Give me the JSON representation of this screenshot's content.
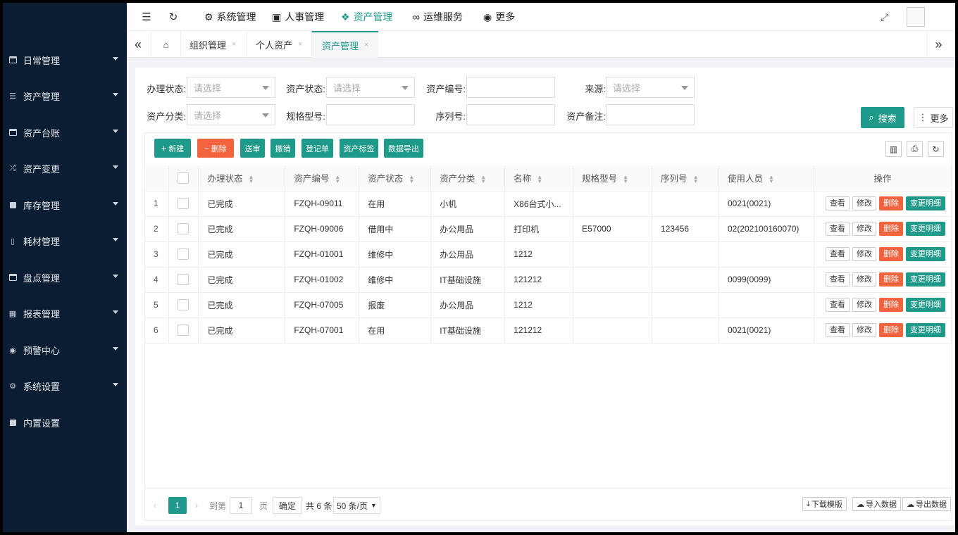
{
  "sidebar": {
    "items": [
      {
        "label": "日常管理",
        "icon": "calendar-icon"
      },
      {
        "label": "资产管理",
        "icon": "server-icon"
      },
      {
        "label": "资产台账",
        "icon": "calendar-icon"
      },
      {
        "label": "资产变更",
        "icon": "shuffle-icon"
      },
      {
        "label": "库存管理",
        "icon": "square-icon"
      },
      {
        "label": "耗材管理",
        "icon": "book-icon"
      },
      {
        "label": "盘点管理",
        "icon": "calendar-check-icon"
      },
      {
        "label": "报表管理",
        "icon": "calendar-grid-icon"
      },
      {
        "label": "预警中心",
        "icon": "dot-circle-icon"
      },
      {
        "label": "系统设置",
        "icon": "gear-icon"
      },
      {
        "label": "内置设置",
        "icon": "square-icon"
      }
    ]
  },
  "topmenu": {
    "items": [
      {
        "label": "系统管理",
        "icon": "gear-icon"
      },
      {
        "label": "人事管理",
        "icon": "id-card-icon"
      },
      {
        "label": "资产管理",
        "icon": "cubes-icon"
      },
      {
        "label": "运维服务",
        "icon": "handshake-icon"
      },
      {
        "label": "更多",
        "icon": "chevron-circle-down-icon"
      }
    ],
    "active": "资产管理"
  },
  "tabs": {
    "items": [
      "组织管理",
      "个人资产",
      "资产管理"
    ],
    "active": "资产管理",
    "close_glyph": "×"
  },
  "filters": {
    "status_label": "办理状态:",
    "asset_status_label": "资产状态:",
    "asset_no_label": "资产编号:",
    "source_label": "来源:",
    "category_label": "资产分类:",
    "model_label": "规格型号:",
    "serial_label": "序列号:",
    "remark_label": "资产备注:",
    "select_placeholder": "请选择",
    "search_label": "搜索",
    "more_label": "更多"
  },
  "toolbar": {
    "new_label": "新建",
    "delete_label": "删除",
    "submit_label": "送审",
    "revoke_label": "撤销",
    "register_label": "登记单",
    "tag_label": "资产标签",
    "export_label": "数据导出"
  },
  "table": {
    "headers": [
      "办理状态",
      "资产编号",
      "资产状态",
      "资产分类",
      "名称",
      "规格型号",
      "序列号",
      "使用人员",
      "操作"
    ],
    "actions": {
      "view": "查看",
      "edit": "修改",
      "delete": "删除",
      "changelog": "变更明细"
    },
    "rows": [
      {
        "idx": "1",
        "status": "已完成",
        "asset_no": "FZQH-09011",
        "asset_status": "在用",
        "category": "小机",
        "name": "X86台式小...",
        "model": "",
        "serial": "",
        "user": "0021(0021)"
      },
      {
        "idx": "2",
        "status": "已完成",
        "asset_no": "FZQH-09006",
        "asset_status": "借用中",
        "category": "办公用品",
        "name": "打印机",
        "model": "E57000",
        "serial": "123456",
        "user": "02(202100160070)"
      },
      {
        "idx": "3",
        "status": "已完成",
        "asset_no": "FZQH-01001",
        "asset_status": "维修中",
        "category": "办公用品",
        "name": "1212",
        "model": "",
        "serial": "",
        "user": ""
      },
      {
        "idx": "4",
        "status": "已完成",
        "asset_no": "FZQH-01002",
        "asset_status": "维修中",
        "category": "IT基础设施",
        "name": "121212",
        "model": "",
        "serial": "",
        "user": "0099(0099)"
      },
      {
        "idx": "5",
        "status": "已完成",
        "asset_no": "FZQH-07005",
        "asset_status": "报废",
        "category": "办公用品",
        "name": "1212",
        "model": "",
        "serial": "",
        "user": ""
      },
      {
        "idx": "6",
        "status": "已完成",
        "asset_no": "FZQH-07001",
        "asset_status": "在用",
        "category": "IT基础设施",
        "name": "121212",
        "model": "",
        "serial": "",
        "user": "0021(0021)"
      }
    ]
  },
  "pager": {
    "current": "1",
    "goto_label": "到第",
    "goto_value": "1",
    "page_unit": "页",
    "confirm_label": "确定",
    "total_label": "共 6 条",
    "page_size": "50 条/页",
    "download_template": "下载模版",
    "import_data": "导入数据",
    "export_data": "导出数据"
  },
  "colors": {
    "accent": "#1f9a8a",
    "danger": "#f2633e",
    "sidebar": "#0b1d33"
  }
}
